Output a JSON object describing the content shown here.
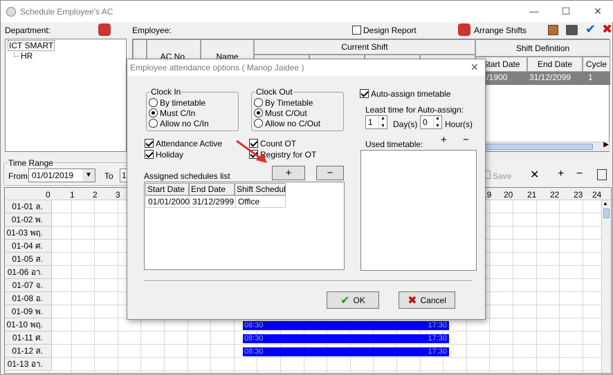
{
  "window": {
    "title": "Schedule Employee's AC"
  },
  "left": {
    "department_label": "Department:",
    "tree": [
      "ICT SMART",
      "HR"
    ]
  },
  "employee": {
    "label": "Employee:",
    "design_report": "Design Report",
    "arrange_shifts": "Arrange Shifts",
    "col_acno": "AC No.",
    "col_name": "Name",
    "current_shift": "Current Shift",
    "shift_definition": "Shift Definition",
    "col_start": "Start Date",
    "col_end": "End Date",
    "col_cycle": "Cycle",
    "row": {
      "start": "01/1900",
      "end": "31/12/2099",
      "cycle": "1"
    }
  },
  "time_range": {
    "label": "Time Range",
    "from_label": "From",
    "from_value": "01/01/2019",
    "to_label": "To",
    "to_value": "1",
    "save": "Save"
  },
  "grid": {
    "hours_left": [
      "0",
      "1",
      "2",
      "3"
    ],
    "hours_right": [
      "19",
      "20",
      "21",
      "22",
      "23",
      "24"
    ],
    "rows": [
      "01-01 ล.",
      "01-02 พ.",
      "01-03 พฤ.",
      "01-04 ศ.",
      "01-05 ส.",
      "01-06 อา.",
      "01-07 จ.",
      "01-08 อ.",
      "01-09 พ.",
      "01-10 พฤ.",
      "01-11 ศ.",
      "01-12 ส.",
      "01-13 อา."
    ],
    "shift_start": "08:30",
    "shift_end": "17:30"
  },
  "dialog": {
    "title": "Employee attendance options ( Manop Jaidee )",
    "clock_in": {
      "label": "Clock In",
      "options": [
        "By timetable",
        "Must C/In",
        "Allow no C/In"
      ],
      "selected": 1
    },
    "clock_out": {
      "label": "Clock Out",
      "options": [
        "By Timetable",
        "Must C/Out",
        "Allow no C/Out"
      ],
      "selected": 1
    },
    "attendance_active": "Attendance Active",
    "holiday": "Holiday",
    "count_ot": "Count OT",
    "registry_ot": "Registry for OT",
    "assigned_label": "Assigned schedules list",
    "assigned_cols": [
      "Start Date",
      "End Date",
      "Shift Schedule"
    ],
    "assigned_rows": [
      [
        "01/01/2000",
        "31/12/2999",
        "Office"
      ]
    ],
    "auto_assign": "Auto-assign timetable",
    "least_time": "Least time for Auto-assign:",
    "days_value": "1",
    "days_label": "Day(s)",
    "hours_value": "0",
    "hours_label": "Hour(s)",
    "used_timetable": "Used timetable:",
    "ok": "OK",
    "cancel": "Cancel"
  },
  "colors": {
    "shift_bar": "#0000ff",
    "arrow": "#e03030"
  }
}
